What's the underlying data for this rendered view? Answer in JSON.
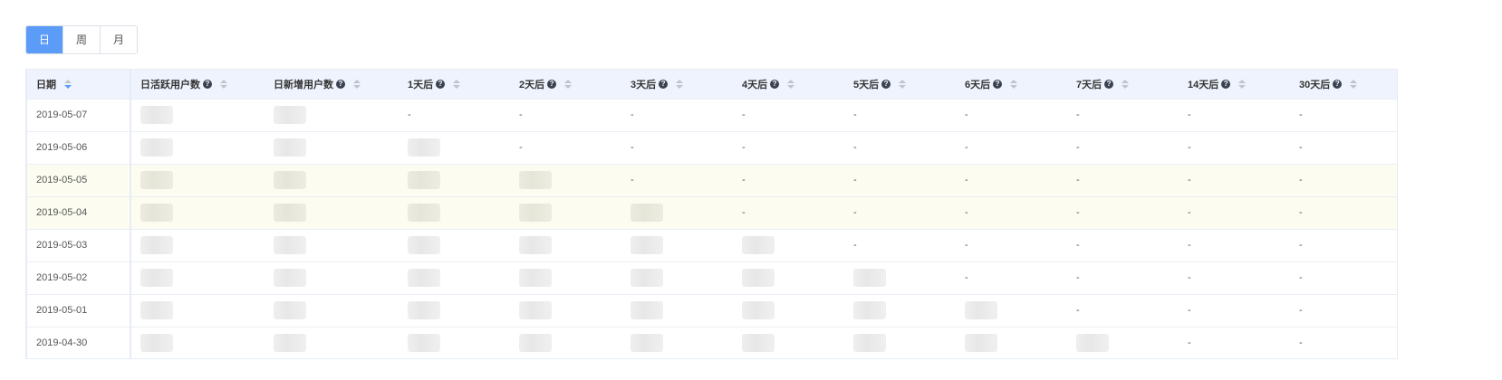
{
  "period_tabs": [
    {
      "label": "日",
      "active": true
    },
    {
      "label": "周",
      "active": false
    },
    {
      "label": "月",
      "active": false
    }
  ],
  "table": {
    "columns": [
      {
        "label": "日期",
        "help": false,
        "sort_active": true
      },
      {
        "label": "日活跃用户数",
        "help": true,
        "sort_active": false
      },
      {
        "label": "日新增用户数",
        "help": true,
        "sort_active": false
      },
      {
        "label": "1天后",
        "help": true,
        "sort_active": false
      },
      {
        "label": "2天后",
        "help": true,
        "sort_active": false
      },
      {
        "label": "3天后",
        "help": true,
        "sort_active": false
      },
      {
        "label": "4天后",
        "help": true,
        "sort_active": false
      },
      {
        "label": "5天后",
        "help": true,
        "sort_active": false
      },
      {
        "label": "6天后",
        "help": true,
        "sort_active": false
      },
      {
        "label": "7天后",
        "help": true,
        "sort_active": false
      },
      {
        "label": "14天后",
        "help": true,
        "sort_active": false
      },
      {
        "label": "30天后",
        "help": true,
        "sort_active": false
      }
    ],
    "help_glyph": "?",
    "rows": [
      {
        "date": "2019-05-07",
        "highlight": false,
        "cells": [
          "#",
          "#",
          "-",
          "-",
          "-",
          "-",
          "-",
          "-",
          "-",
          "-",
          "-"
        ]
      },
      {
        "date": "2019-05-06",
        "highlight": false,
        "cells": [
          "#",
          "#",
          "#",
          "-",
          "-",
          "-",
          "-",
          "-",
          "-",
          "-",
          "-"
        ]
      },
      {
        "date": "2019-05-05",
        "highlight": true,
        "cells": [
          "#",
          "#",
          "#",
          "#",
          "-",
          "-",
          "-",
          "-",
          "-",
          "-",
          "-"
        ]
      },
      {
        "date": "2019-05-04",
        "highlight": true,
        "cells": [
          "#",
          "#",
          "#",
          "#",
          "#",
          "-",
          "-",
          "-",
          "-",
          "-",
          "-"
        ]
      },
      {
        "date": "2019-05-03",
        "highlight": false,
        "cells": [
          "#",
          "#",
          "#",
          "#",
          "#",
          "#",
          "-",
          "-",
          "-",
          "-",
          "-"
        ]
      },
      {
        "date": "2019-05-02",
        "highlight": false,
        "cells": [
          "#",
          "#",
          "#",
          "#",
          "#",
          "#",
          "#",
          "-",
          "-",
          "-",
          "-"
        ]
      },
      {
        "date": "2019-05-01",
        "highlight": false,
        "cells": [
          "#",
          "#",
          "#",
          "#",
          "#",
          "#",
          "#",
          "#",
          "-",
          "-",
          "-"
        ]
      },
      {
        "date": "2019-04-30",
        "highlight": false,
        "cells": [
          "#",
          "#",
          "#",
          "#",
          "#",
          "#",
          "#",
          "#",
          "#",
          "-",
          "-"
        ]
      }
    ]
  },
  "colors": {
    "accent": "#5b9cf8",
    "header_bg": "#eef3fd",
    "highlight_row": "#fcfdf0"
  }
}
